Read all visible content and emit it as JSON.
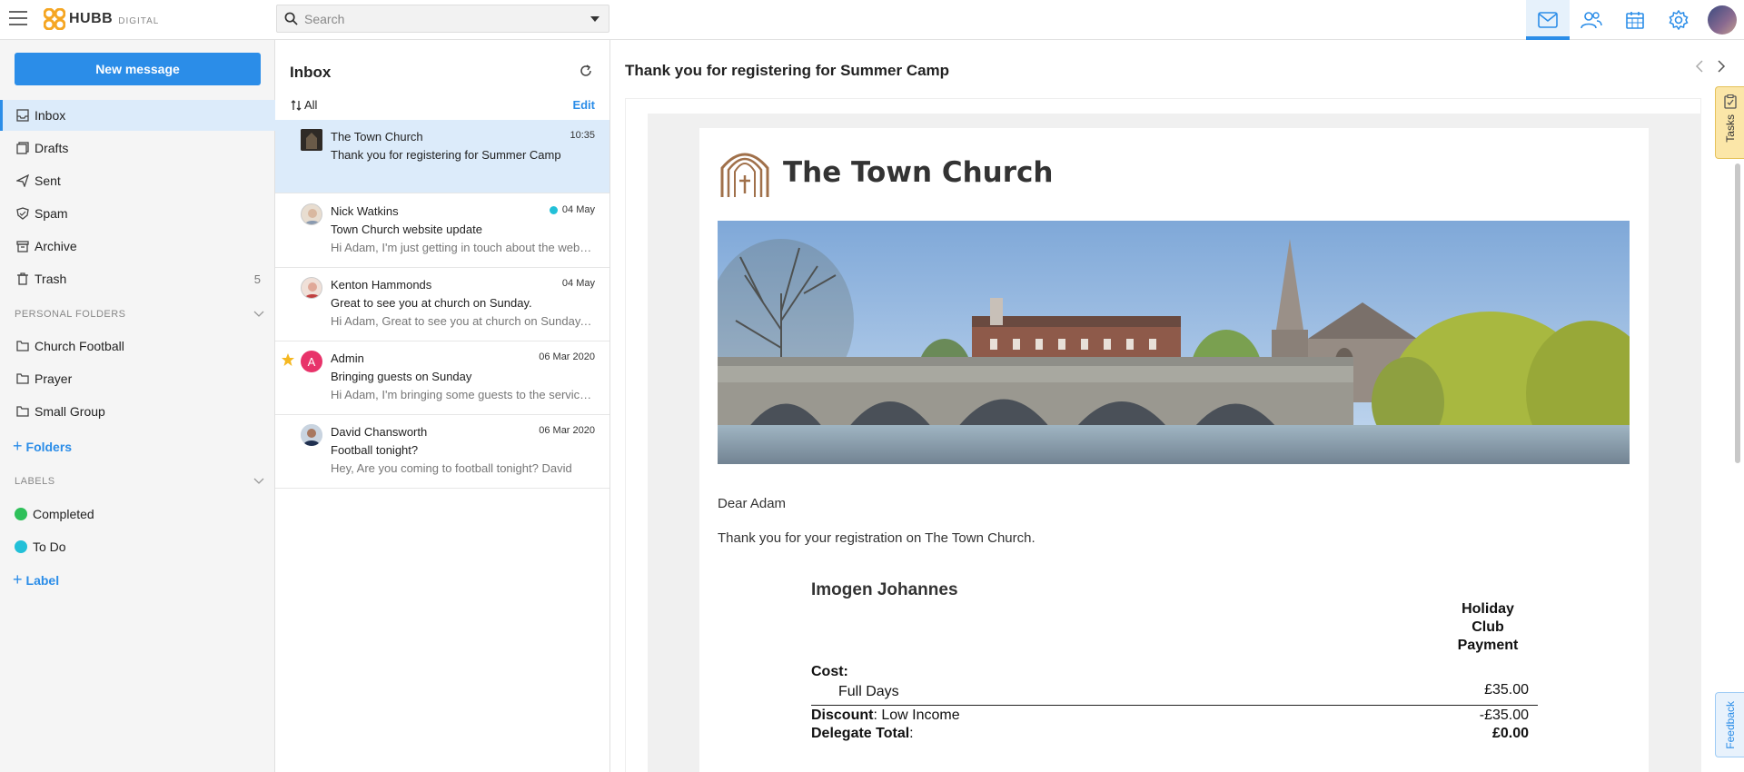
{
  "app": {
    "logo_text": "HUBB",
    "logo_sub": "DIGITAL",
    "brand_color": "#2b8de8"
  },
  "search": {
    "placeholder": "Search"
  },
  "top_icons": [
    "mail-icon",
    "contacts-icon",
    "calendar-icon",
    "settings-icon",
    "user-avatar"
  ],
  "sidebar": {
    "new_message_label": "New message",
    "items": [
      {
        "label": "Inbox",
        "icon": "inbox-icon",
        "active": true
      },
      {
        "label": "Drafts",
        "icon": "drafts-icon"
      },
      {
        "label": "Sent",
        "icon": "sent-icon"
      },
      {
        "label": "Spam",
        "icon": "spam-icon"
      },
      {
        "label": "Archive",
        "icon": "archive-icon"
      },
      {
        "label": "Trash",
        "icon": "trash-icon",
        "count": "5"
      }
    ],
    "personal_folders_heading": "PERSONAL FOLDERS",
    "folders": [
      "Church Football",
      "Prayer",
      "Small Group"
    ],
    "add_folders_label": "Folders",
    "labels_heading": "LABELS",
    "labels": [
      {
        "label": "Completed",
        "color": "#2ec05a"
      },
      {
        "label": "To Do",
        "color": "#22c0d8"
      }
    ],
    "add_label_label": "Label"
  },
  "list": {
    "title": "Inbox",
    "sort_label": "All",
    "edit_label": "Edit",
    "messages": [
      {
        "sender": "The Town Church",
        "date": "10:35",
        "subject": "Thank you for registering for Summer Camp",
        "preview": "",
        "selected": true
      },
      {
        "sender": "Nick Watkins",
        "date": "04 May",
        "subject": "Town Church website update",
        "preview": "Hi Adam, I'm just getting in touch about the website update…",
        "unread_dot": true
      },
      {
        "sender": "Kenton Hammonds",
        "date": "04 May",
        "subject": "Great to see you at church on Sunday.",
        "preview": "Hi Adam, Great to see you at church on Sunday. …"
      },
      {
        "sender": "Admin",
        "date": "06 Mar 2020",
        "subject": "Bringing guests on Sunday",
        "preview": "Hi Adam, I'm bringing some guests to the service on Sunday",
        "starred": true,
        "avatar_letter": "A"
      },
      {
        "sender": "David Chansworth",
        "date": "06 Mar 2020",
        "subject": "Football tonight?",
        "preview": "Hey, Are you coming to football tonight? David"
      }
    ]
  },
  "reader": {
    "title": "Thank you for registering for Summer Camp",
    "church_name": "The Town Church",
    "greeting": "Dear Adam",
    "body": "Thank you for your registration on The Town Church.",
    "registrant": "Imogen Johannes",
    "column_heading": "Holiday Club Payment",
    "cost_label": "Cost:",
    "line_item": "Full Days",
    "line_value": "£35.00",
    "discount_label": "Discount",
    "discount_type": ": Low Income",
    "discount_value": "-£35.00",
    "total_label": "Delegate Total",
    "total_value": "£0.00"
  },
  "side_tabs": {
    "tasks": "Tasks",
    "feedback": "Feedback"
  }
}
